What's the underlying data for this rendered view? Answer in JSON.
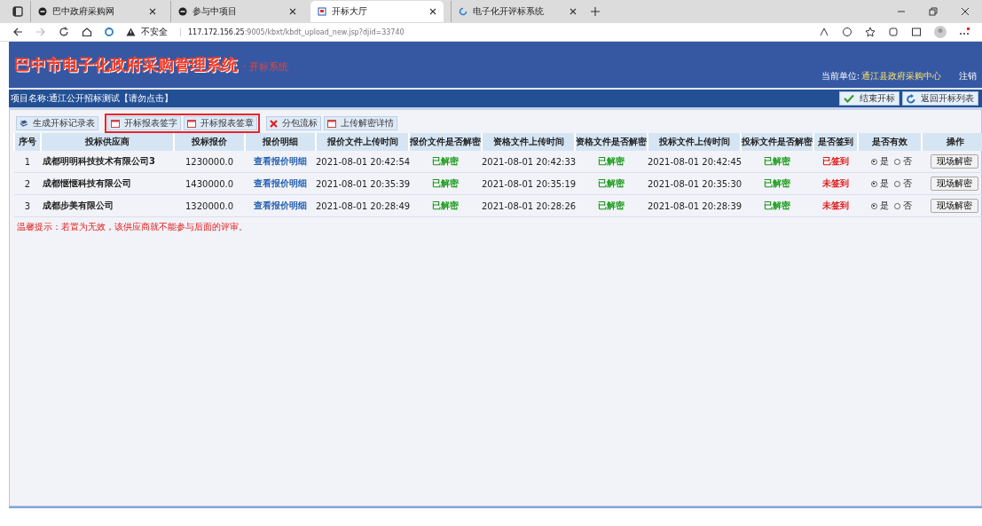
{
  "browser": {
    "tabs": [
      {
        "title": "巴中政府采购网",
        "kind": "ie",
        "selected": false
      },
      {
        "title": "参与中项目",
        "kind": "ie",
        "selected": false
      },
      {
        "title": "开标大厅",
        "kind": "page",
        "selected": true
      },
      {
        "title": "电子化开评标系统",
        "kind": "loader",
        "selected": false
      }
    ],
    "security": "不安全",
    "url_host": "117.172.156.25",
    "url_path": ":9005/kbxt/kbdt_upload_new.jsp?djid=33740"
  },
  "header": {
    "title": "巴中市电子化政府采购管理系统",
    "subtitle": "· 开标系统",
    "unit_label": "当前单位:",
    "unit": "通江县政府采购中心",
    "logout": "注销"
  },
  "project_bar": {
    "label": "项目名称:",
    "name": "通江公开招标测试【请勿点击】",
    "buttons": [
      {
        "label": "结束开标",
        "kind": "check"
      },
      {
        "label": "返回开标列表",
        "kind": "refresh"
      }
    ]
  },
  "toolbar": {
    "groups": [
      {
        "highlighted": false,
        "buttons": [
          {
            "label": "生成开标记录表",
            "kind": "report"
          }
        ]
      },
      {
        "highlighted": true,
        "buttons": [
          {
            "label": "开标报表签字",
            "kind": "calendar"
          },
          {
            "label": "开标报表签章",
            "kind": "calendar"
          }
        ]
      },
      {
        "highlighted": false,
        "buttons": [
          {
            "label": "分包流标",
            "kind": "cross"
          },
          {
            "label": "上传解密详情",
            "kind": "calendar"
          }
        ]
      }
    ]
  },
  "table": {
    "columns": [
      "序号",
      "投标供应商",
      "投标报价",
      "报价明细",
      "报价文件上传时间",
      "报价文件是否解密",
      "资格文件上传时间",
      "资格文件是否解密",
      "投标文件上传时间",
      "投标文件是否解密",
      "是否签到",
      "是否有效",
      "操作"
    ],
    "rows": [
      {
        "no": "1",
        "supplier": "成都明明科技技术有限公司3",
        "price": "1230000.0",
        "detail": "查看报价明细",
        "quote_time": "2021-08-01 20:42:54",
        "quote_status": "已解密",
        "qual_time": "2021-08-01 20:42:33",
        "qual_status": "已解密",
        "bid_time": "2021-08-01 20:42:45",
        "bid_status": "已解密",
        "signin": "已签到",
        "valid": true,
        "yes": "是",
        "no_label": "否",
        "action": "现场解密"
      },
      {
        "no": "2",
        "supplier": "成都惬惬科技有限公司",
        "price": "1430000.0",
        "detail": "查看报价明细",
        "quote_time": "2021-08-01 20:35:39",
        "quote_status": "已解密",
        "qual_time": "2021-08-01 20:35:19",
        "qual_status": "已解密",
        "bid_time": "2021-08-01 20:35:30",
        "bid_status": "已解密",
        "signin": "未签到",
        "valid": true,
        "yes": "是",
        "no_label": "否",
        "action": "现场解密"
      },
      {
        "no": "3",
        "supplier": "成都步美有限公司",
        "price": "1320000.0",
        "detail": "查看报价明细",
        "quote_time": "2021-08-01 20:28:49",
        "quote_status": "已解密",
        "qual_time": "2021-08-01 20:28:26",
        "qual_status": "已解密",
        "bid_time": "2021-08-01 20:28:39",
        "bid_status": "已解密",
        "signin": "未签到",
        "valid": true,
        "yes": "是",
        "no_label": "否",
        "action": "现场解密"
      }
    ]
  },
  "notice": "温馨提示：若置为无效，该供应商就不能参与后面的评审。"
}
